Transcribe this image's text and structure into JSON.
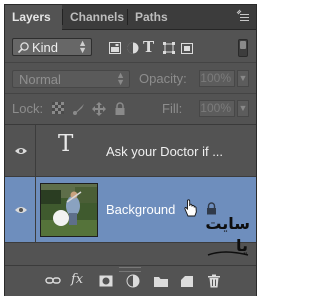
{
  "tabs": [
    {
      "label": "Layers"
    },
    {
      "label": "Channels"
    },
    {
      "label": "Paths"
    }
  ],
  "filter": {
    "kind_label": "Kind",
    "icons": [
      "pixel-filter-icon",
      "adjustment-filter-icon",
      "type-filter-icon",
      "shape-filter-icon",
      "smart-object-filter-icon"
    ]
  },
  "blend": {
    "mode": "Normal",
    "opacity_label": "Opacity:",
    "opacity_value": "100%"
  },
  "lock": {
    "label": "Lock:",
    "fill_label": "Fill:",
    "fill_value": "100%"
  },
  "layers": [
    {
      "name": "Ask your Doctor if ...",
      "type": "text",
      "selected": false
    },
    {
      "name": "Background",
      "type": "pixel",
      "selected": true,
      "locked": true
    }
  ],
  "bottom_icons": [
    "link-layers-icon",
    "fx-icon",
    "add-mask-icon",
    "adjustment-layer-icon",
    "new-group-icon",
    "new-layer-icon",
    "delete-layer-icon"
  ],
  "colors": {
    "panel": "#535353",
    "selected_row": "#6e8ebd",
    "tab_bar": "#3c3c3c"
  }
}
